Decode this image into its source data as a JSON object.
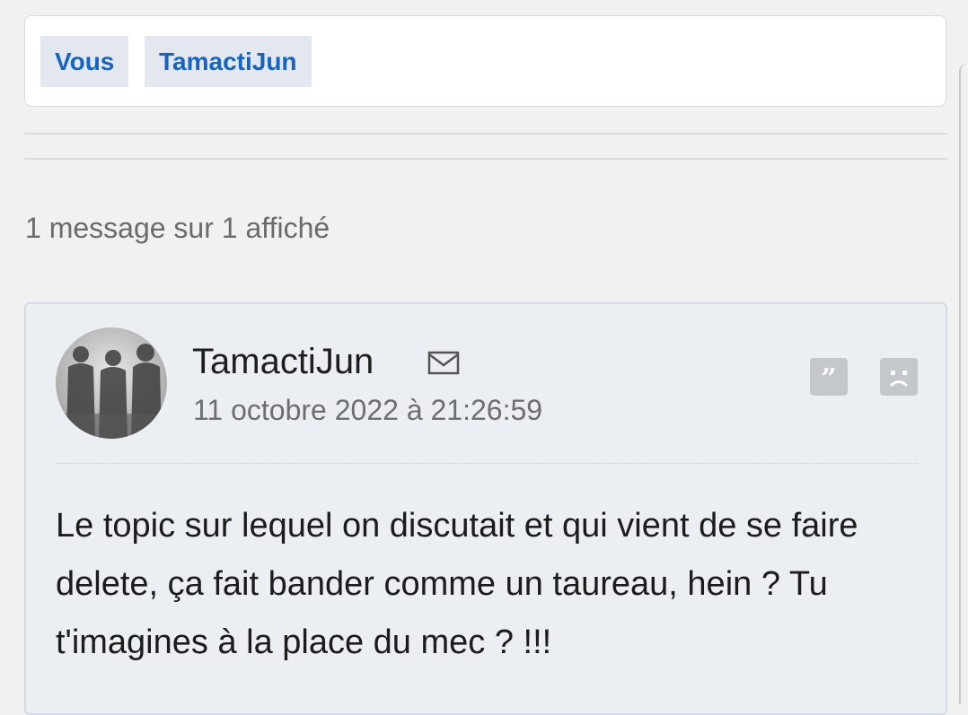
{
  "participants": {
    "you_label": "Vous",
    "user_label": "TamactiJun"
  },
  "message_count": "1 message sur 1 affiché",
  "message": {
    "author": "TamactiJun",
    "timestamp": "11 octobre 2022 à 21:26:59",
    "body": "Le topic sur lequel on discutait et qui vient de se faire delete, ça fait bander comme un taureau, hein ? Tu t'imagines à la place du mec ? !!!",
    "icons": {
      "avatar": "avatar-image",
      "mail": "mail-icon",
      "quote": "quote-icon",
      "report": "sad-face-report-icon"
    }
  },
  "colors": {
    "accent": "#1565c0",
    "chip_bg": "#e3e8f0",
    "card_bg": "#ebeef3",
    "page_bg": "#f1f1f1"
  }
}
